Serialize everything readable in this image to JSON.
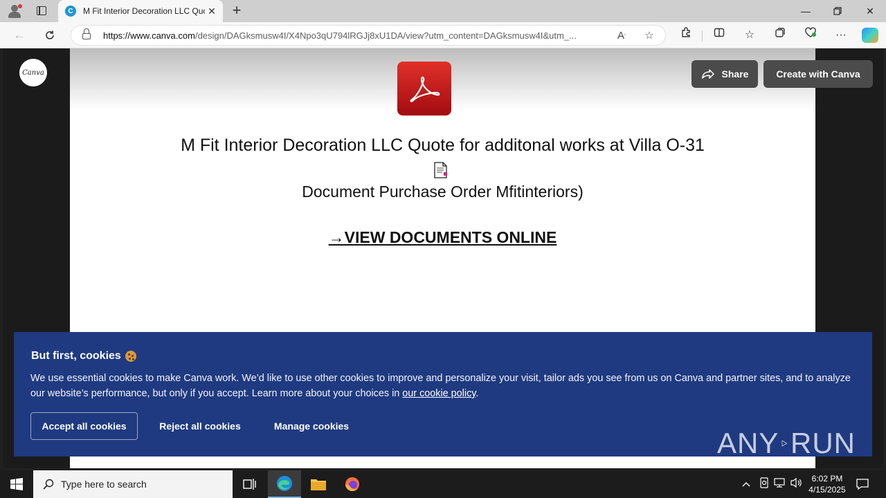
{
  "browser": {
    "tab_title": "M Fit Interior Decoration LLC Quo",
    "tab_favicon": "C",
    "url_host": "https://www.canva.com",
    "url_path": "/design/DAGksmusw4I/X4Npo3qU794lRGJj8xU1DA/view?utm_content=DAGksmusw4I&utm_..."
  },
  "page": {
    "logo_text": "Canva",
    "share_label": "Share",
    "create_label": "Create with Canva",
    "doc_title": "M Fit Interior Decoration LLC Quote for additonal works at Villa O-31",
    "doc_subtitle": "Document Purchase Order Mfitinteriors)",
    "view_link": "→VIEW DOCUMENTS ONLINE"
  },
  "cookie": {
    "title": "But first, cookies",
    "body": "We use essential cookies to make Canva work. We’d like to use other cookies to improve and personalize your visit, tailor ads you see from us on Canva and partner sites, and to analyze our website’s performance, but only if you accept. Learn more about your choices in",
    "policy_link": "our cookie policy",
    "body_end": ".",
    "accept_label": "Accept all cookies",
    "reject_label": "Reject all cookies",
    "manage_label": "Manage cookies"
  },
  "watermark": {
    "left": "ANY",
    "right": "RUN"
  },
  "taskbar": {
    "search_placeholder": "Type here to search",
    "time": "6:02 PM",
    "date": "4/15/2025"
  },
  "colors": {
    "banner": "#1f3a80",
    "canva_button": "#4b4b4b",
    "pdf_red": "#c4161c"
  }
}
